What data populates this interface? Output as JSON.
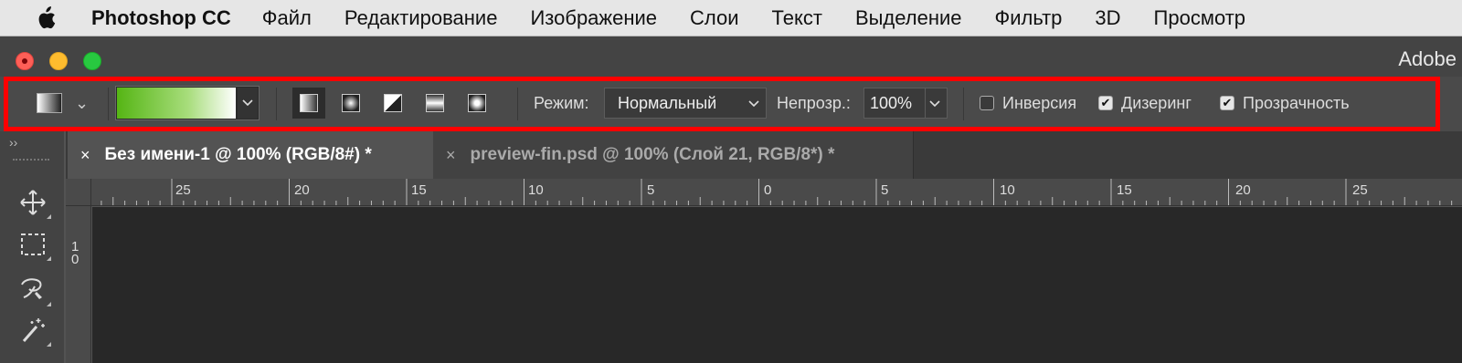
{
  "menubar": {
    "app_name": "Photoshop CC",
    "items": [
      "Файл",
      "Редактирование",
      "Изображение",
      "Слои",
      "Текст",
      "Выделение",
      "Фильтр",
      "3D",
      "Просмотр"
    ]
  },
  "window": {
    "title": "Adobe"
  },
  "options": {
    "mode_label": "Режим:",
    "mode_value": "Нормальный",
    "opacity_label": "Непрозр.:",
    "opacity_value": "100%",
    "inverse_label": "Инверсия",
    "inverse_checked": false,
    "dither_label": "Дизеринг",
    "dither_checked": true,
    "transparency_label": "Прозрачность",
    "transparency_checked": true,
    "gradient_colors": [
      "#55b514",
      "#ffffff"
    ],
    "highlight_color": "#ff0000"
  },
  "tabs": [
    {
      "close": "×",
      "label": "Без имени-1 @ 100% (RGB/8#) *",
      "active": true
    },
    {
      "close": "×",
      "label": "preview-fin.psd @ 100% (Слой 21, RGB/8*) *",
      "active": false
    }
  ],
  "ruler_top": [
    "25",
    "20",
    "15",
    "10",
    "5",
    "0",
    "5",
    "10",
    "15",
    "20",
    "25"
  ],
  "ruler_left": [
    "1",
    "0"
  ],
  "tools": [
    "move-icon",
    "marquee-icon",
    "lasso-icon",
    "magic-wand-icon"
  ],
  "collapse_glyph": "››"
}
